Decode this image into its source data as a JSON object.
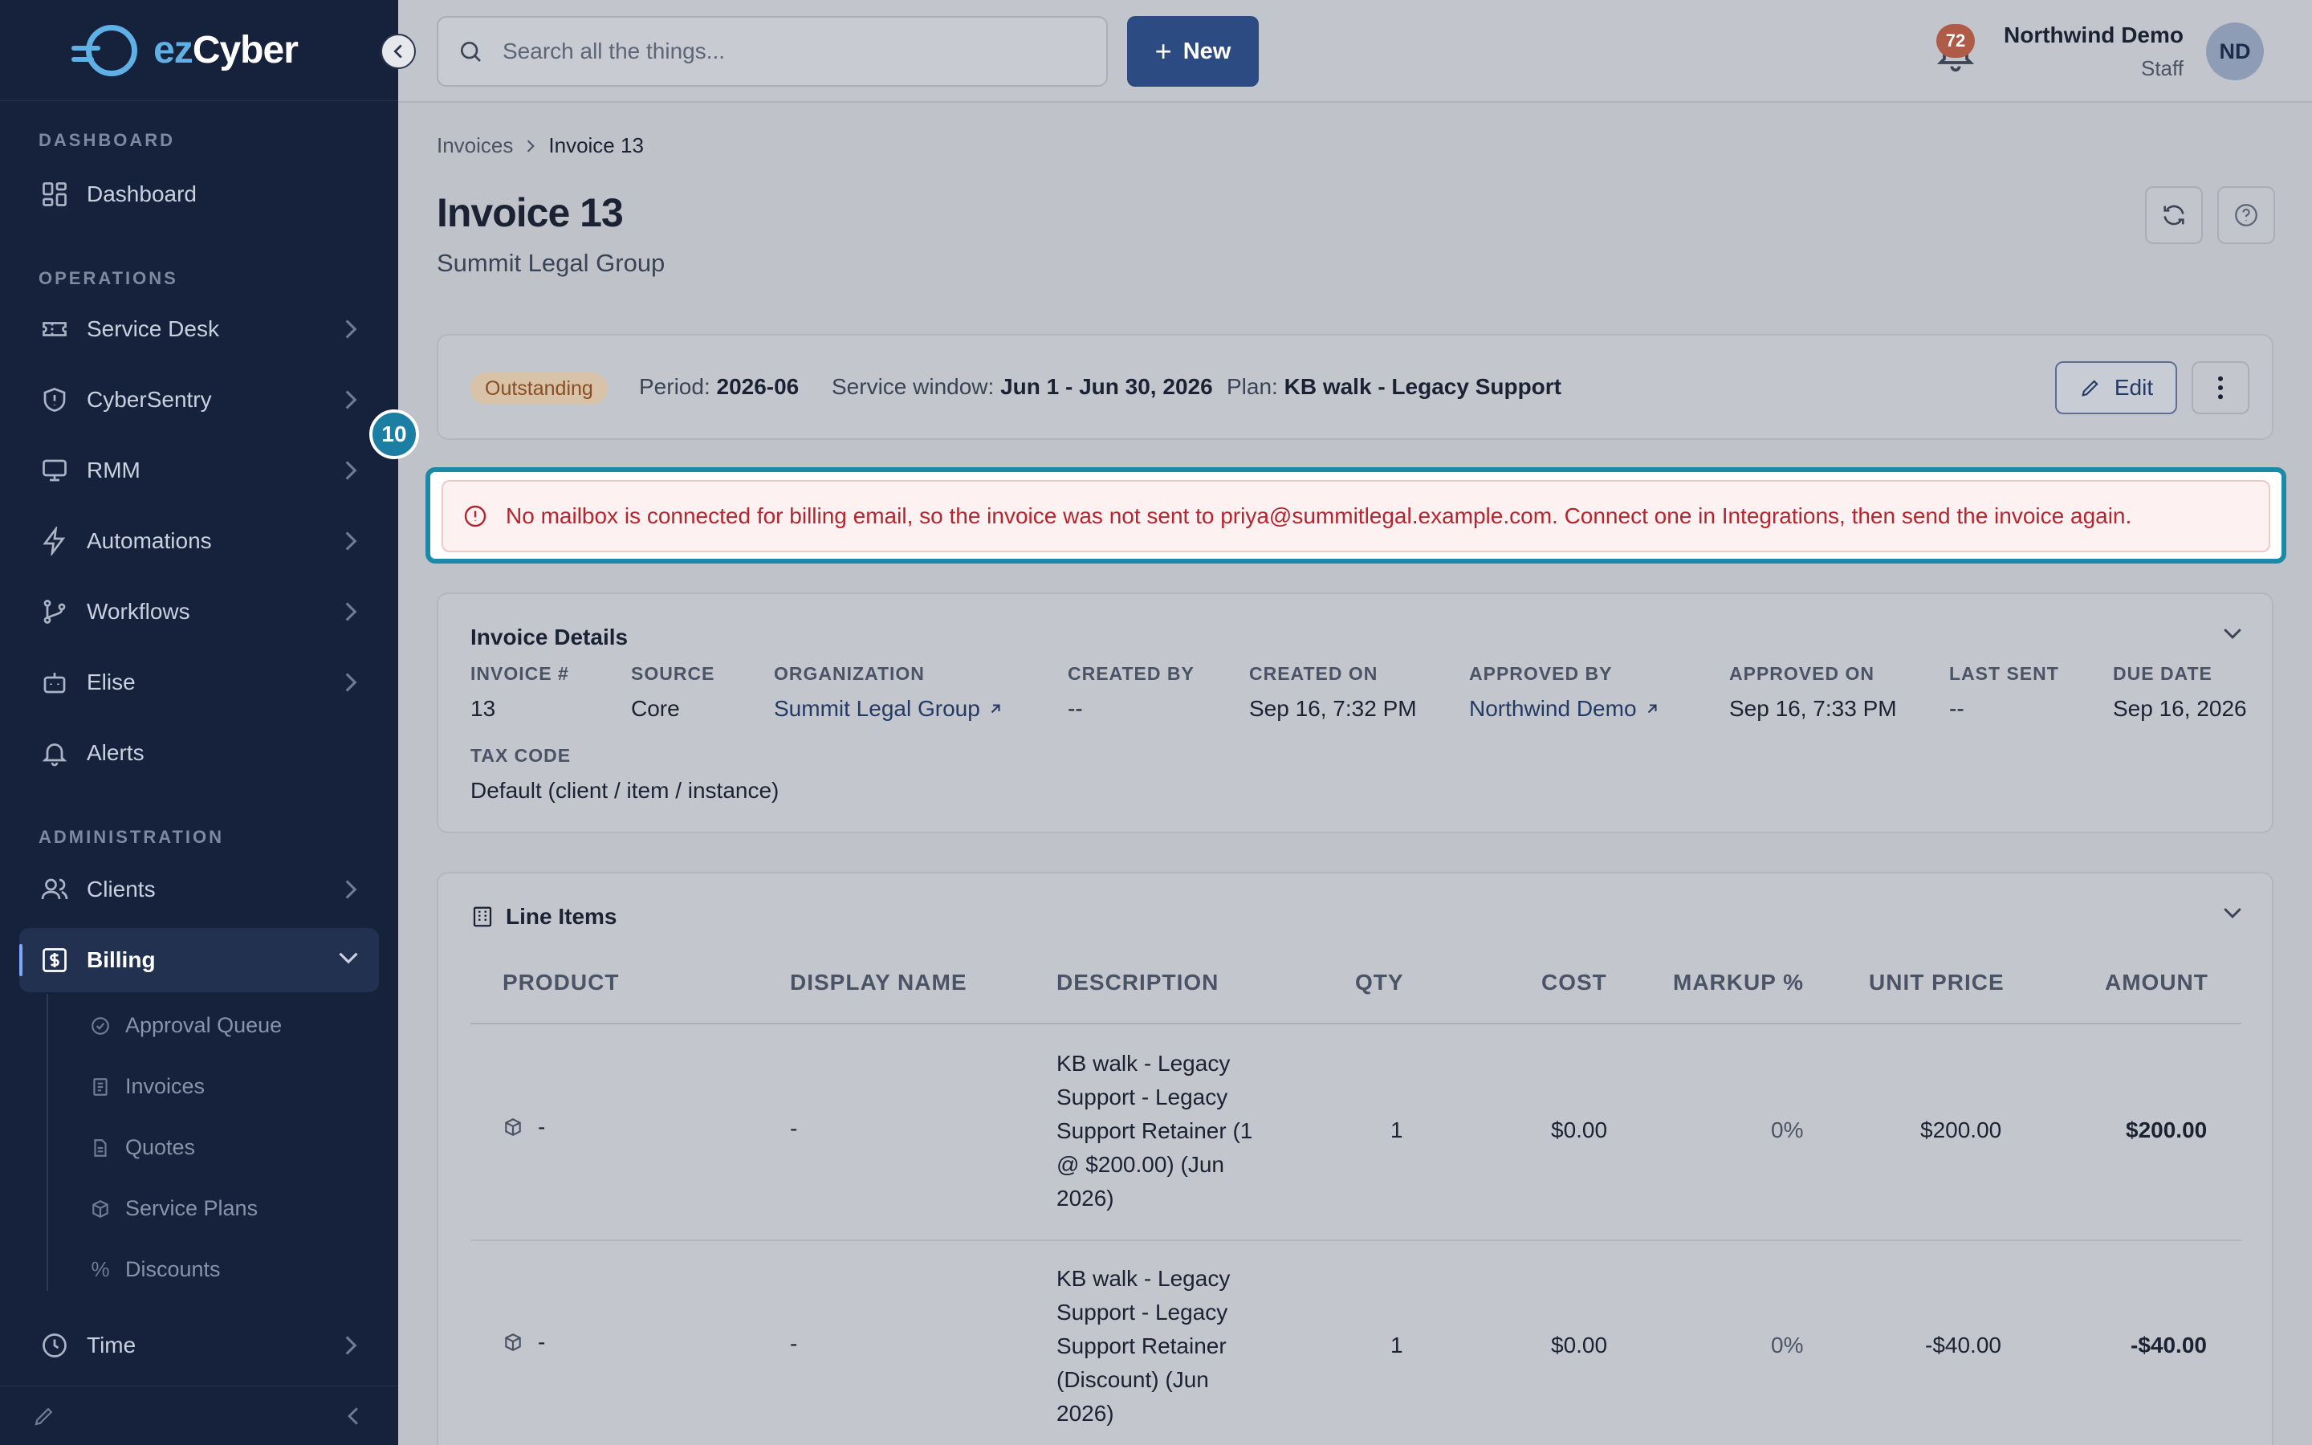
{
  "brand": {
    "logo_ez": "ez",
    "logo_cyber": "Cyber"
  },
  "sidebar": {
    "sections": {
      "dashboard": "DASHBOARD",
      "operations": "OPERATIONS",
      "administration": "ADMINISTRATION"
    },
    "items": {
      "dashboard": "Dashboard",
      "service_desk": "Service Desk",
      "cybersentry": "CyberSentry",
      "rmm": "RMM",
      "automations": "Automations",
      "workflows": "Workflows",
      "elise": "Elise",
      "alerts": "Alerts",
      "clients": "Clients",
      "billing": "Billing",
      "time": "Time"
    },
    "billing_sub": {
      "approval_queue": "Approval Queue",
      "invoices": "Invoices",
      "quotes": "Quotes",
      "service_plans": "Service Plans",
      "discounts": "Discounts"
    }
  },
  "topbar": {
    "search_placeholder": "Search all the things...",
    "new_label": "New",
    "notification_count": "72",
    "user_name": "Northwind Demo",
    "user_role": "Staff",
    "avatar_initials": "ND"
  },
  "breadcrumb": {
    "parent": "Invoices",
    "current": "Invoice 13"
  },
  "page": {
    "title": "Invoice 13",
    "subtitle": "Summit Legal Group"
  },
  "status": {
    "badge": "Outstanding",
    "period_label": "Period:",
    "period_value": "2026-06",
    "window_label": "Service window:",
    "window_value": "Jun 1 - Jun 30, 2026",
    "plan_label": "Plan:",
    "plan_value": "KB walk - Legacy Support",
    "edit_label": "Edit"
  },
  "step_marker": "10",
  "alert": {
    "message": "No mailbox is connected for billing email, so the invoice was not sent to priya@summitlegal.example.com. Connect one in Integrations, then send the invoice again."
  },
  "details": {
    "title": "Invoice Details",
    "invoice_no": {
      "label": "INVOICE #",
      "value": "13"
    },
    "source": {
      "label": "SOURCE",
      "value": "Core"
    },
    "organization": {
      "label": "ORGANIZATION",
      "value": "Summit Legal Group"
    },
    "created_by": {
      "label": "CREATED BY",
      "value": "--"
    },
    "created_on": {
      "label": "CREATED ON",
      "value": "Sep 16, 7:32 PM"
    },
    "approved_by": {
      "label": "APPROVED BY",
      "value": "Northwind Demo"
    },
    "approved_on": {
      "label": "APPROVED ON",
      "value": "Sep 16, 7:33 PM"
    },
    "last_sent": {
      "label": "LAST SENT",
      "value": "--"
    },
    "due_date": {
      "label": "DUE DATE",
      "value": "Sep 16, 2026"
    },
    "tax_code": {
      "label": "TAX CODE",
      "value": "Default (client / item / instance)"
    }
  },
  "line_items": {
    "title": "Line Items",
    "columns": [
      "PRODUCT",
      "DISPLAY NAME",
      "DESCRIPTION",
      "QTY",
      "COST",
      "MARKUP %",
      "UNIT PRICE",
      "AMOUNT"
    ],
    "rows": [
      {
        "product": "-",
        "display_name": "-",
        "description_lines": [
          "KB walk - Legacy",
          "Support - Legacy",
          "Support Retainer (1",
          "@ $200.00) (Jun",
          "2026)"
        ],
        "qty": "1",
        "cost": "$0.00",
        "markup": "0%",
        "unit_price": "$200.00",
        "amount": "$200.00"
      },
      {
        "product": "-",
        "display_name": "-",
        "description_lines": [
          "KB walk - Legacy",
          "Support - Legacy",
          "Support Retainer",
          "(Discount) (Jun",
          "2026)"
        ],
        "qty": "1",
        "cost": "$0.00",
        "markup": "0%",
        "unit_price": "-$40.00",
        "amount": "-$40.00"
      }
    ]
  },
  "colors": {
    "sidebar_bg": "#16223b",
    "primary": "#2c4b83",
    "alert_text": "#b3262e",
    "highlight": "#1b8aa8",
    "outstanding": "#8a4c22"
  }
}
